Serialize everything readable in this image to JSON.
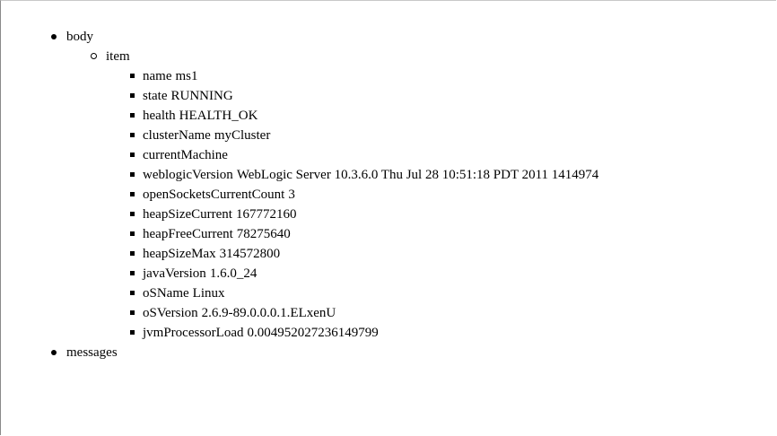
{
  "tree": {
    "root": [
      {
        "label": "body",
        "children": [
          {
            "label": "item",
            "fields": [
              {
                "key": "name",
                "value": "ms1"
              },
              {
                "key": "state",
                "value": "RUNNING"
              },
              {
                "key": "health",
                "value": "HEALTH_OK"
              },
              {
                "key": "clusterName",
                "value": "myCluster"
              },
              {
                "key": "currentMachine",
                "value": ""
              },
              {
                "key": "weblogicVersion",
                "value": "WebLogic Server 10.3.6.0 Thu Jul 28 10:51:18 PDT 2011 1414974"
              },
              {
                "key": "openSocketsCurrentCount",
                "value": "3"
              },
              {
                "key": "heapSizeCurrent",
                "value": "167772160"
              },
              {
                "key": "heapFreeCurrent",
                "value": "78275640"
              },
              {
                "key": "heapSizeMax",
                "value": "314572800"
              },
              {
                "key": "javaVersion",
                "value": "1.6.0_24"
              },
              {
                "key": "oSName",
                "value": "Linux"
              },
              {
                "key": "oSVersion",
                "value": "2.6.9-89.0.0.0.1.ELxenU"
              },
              {
                "key": "jvmProcessorLoad",
                "value": "0.004952027236149799"
              }
            ]
          }
        ]
      },
      {
        "label": "messages",
        "children": []
      }
    ]
  }
}
